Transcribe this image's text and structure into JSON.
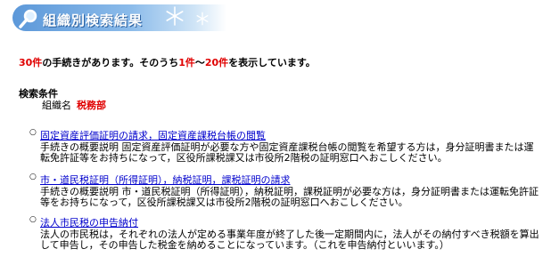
{
  "header": {
    "title": "組織別検索結果",
    "icon": "magnifier-icon",
    "decoration_icon": "snowflake-icon"
  },
  "summary": {
    "total": "30件",
    "text1": "の手続きがあります。そのうち",
    "from": "1件",
    "sep": "〜",
    "to": "20件",
    "text2": "を表示しています。"
  },
  "conditions": {
    "heading": "検索条件",
    "label": "組織名",
    "value": "税務部"
  },
  "results": [
    {
      "title": "固定資産評価証明の請求，固定資産課税台帳の閲覧",
      "description": "手続きの概要説明 固定資産評価証明が必要な方や固定資産課税台帳の閲覧を希望する方は，身分証明書または運転免許証等をお持ちになって，区役所課税課又は市役所2階税の証明窓口へおこしください。"
    },
    {
      "title": "市・道民税証明（所得証明），納税証明，課税証明の請求",
      "description": "手続きの概要説明 市・道民税証明（所得証明），納税証明，課税証明が必要な方は，身分証明書または運転免許証等をお持ちになって，区役所課税課又は市役所2階税の証明窓口へおこしください。"
    },
    {
      "title": "法人市民税の申告納付",
      "description": "法人の市民税は，それぞれの法人が定める事業年度が終了した後一定期間内に，法人がその納付すべき税額を算出して申告し，その申告した税金を納めることになっています。（これを申告納付といいます。）"
    }
  ],
  "colors": {
    "accent_red": "#e00000",
    "link_blue": "#0000cc",
    "banner_blue": "#5c98d9"
  }
}
